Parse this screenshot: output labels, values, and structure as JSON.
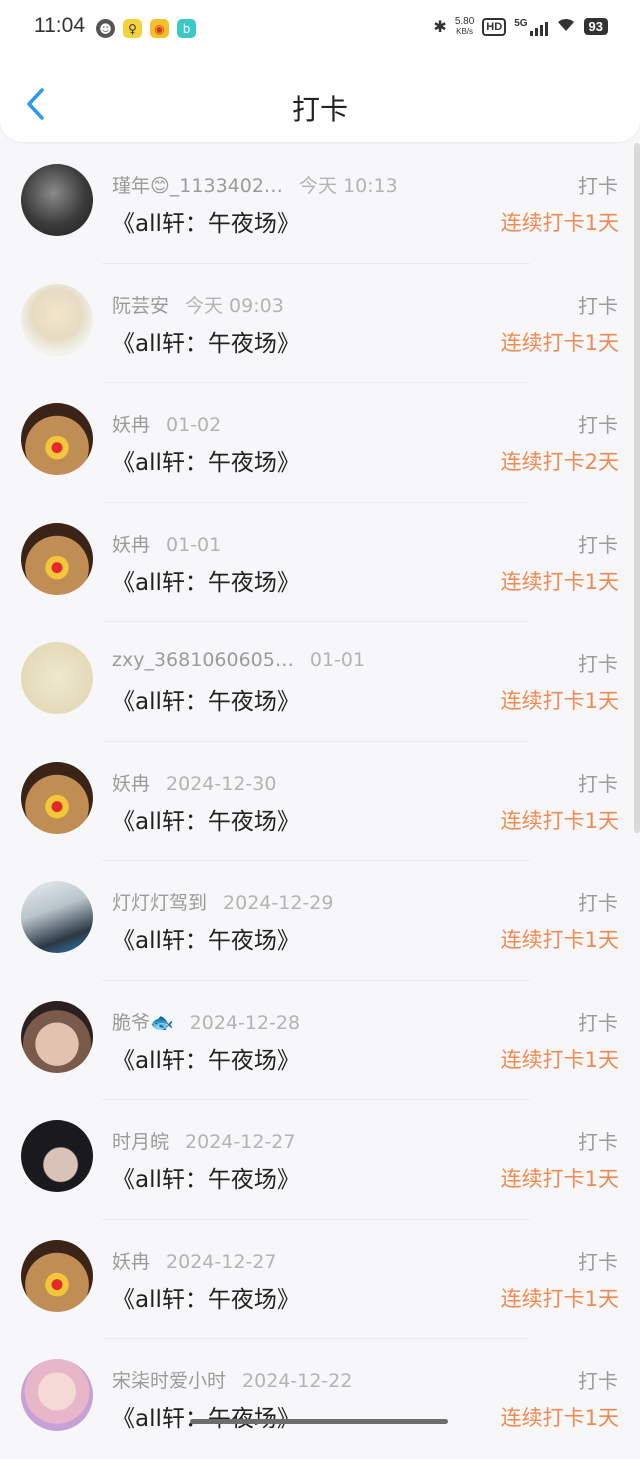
{
  "status_bar": {
    "time": "11:04",
    "net_speed_value": "5.80",
    "net_speed_unit": "KB/s",
    "hd": "HD",
    "network": "5G",
    "battery": "93"
  },
  "header": {
    "title": "打卡"
  },
  "rows": [
    {
      "user": "瑾年😊_1133402…",
      "time": "今天 10:13",
      "book": "《all轩：午夜场》",
      "tag": "打卡",
      "streak": "连续打卡1天"
    },
    {
      "user": "阮芸安",
      "time": "今天 09:03",
      "book": "《all轩：午夜场》",
      "tag": "打卡",
      "streak": "连续打卡1天"
    },
    {
      "user": "妖冉",
      "time": "01-02",
      "book": "《all轩：午夜场》",
      "tag": "打卡",
      "streak": "连续打卡2天"
    },
    {
      "user": "妖冉",
      "time": "01-01",
      "book": "《all轩：午夜场》",
      "tag": "打卡",
      "streak": "连续打卡1天"
    },
    {
      "user": "zxy_3681060605…",
      "time": "01-01",
      "book": "《all轩：午夜场》",
      "tag": "打卡",
      "streak": "连续打卡1天"
    },
    {
      "user": "妖冉",
      "time": "2024-12-30",
      "book": "《all轩：午夜场》",
      "tag": "打卡",
      "streak": "连续打卡1天"
    },
    {
      "user": "灯灯灯驾到",
      "time": "2024-12-29",
      "book": "《all轩：午夜场》",
      "tag": "打卡",
      "streak": "连续打卡1天"
    },
    {
      "user": "脆爷🐟",
      "time": "2024-12-28",
      "book": "《all轩：午夜场》",
      "tag": "打卡",
      "streak": "连续打卡1天"
    },
    {
      "user": "时月皖",
      "time": "2024-12-27",
      "book": "《all轩：午夜场》",
      "tag": "打卡",
      "streak": "连续打卡1天"
    },
    {
      "user": "妖冉",
      "time": "2024-12-27",
      "book": "《all轩：午夜场》",
      "tag": "打卡",
      "streak": "连续打卡1天"
    },
    {
      "user": "宋柒时爱小时",
      "time": "2024-12-22",
      "book": "《all轩：午夜场》",
      "tag": "打卡",
      "streak": "连续打卡1天"
    }
  ],
  "colors": {
    "accent_back": "#2a9bf0",
    "streak": "#ef8a50"
  }
}
